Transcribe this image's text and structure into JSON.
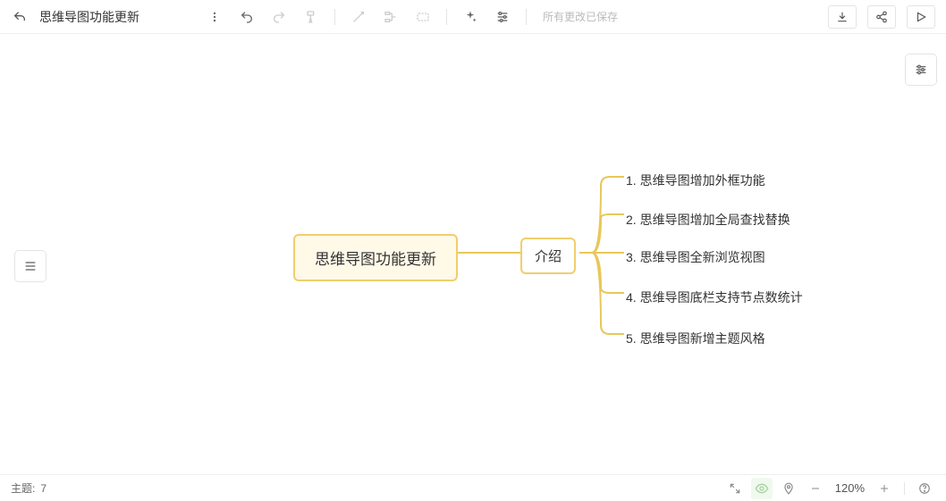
{
  "toolbar": {
    "title": "思维导图功能更新",
    "save_status": "所有更改已保存"
  },
  "mindmap": {
    "root": "思维导图功能更新",
    "child": "介绍",
    "leaves": [
      "1. 思维导图增加外框功能",
      "2. 思维导图增加全局查找替换",
      "3. 思维导图全新浏览视图",
      "4. 思维导图底栏支持节点数统计",
      "5. 思维导图新增主题风格"
    ]
  },
  "statusbar": {
    "topic_label": "主题:",
    "topic_count": "7",
    "zoom": "120%"
  },
  "colors": {
    "node_border": "#F0CE6C",
    "node_bg": "#FFF9E8",
    "connector": "#E8C75A"
  }
}
